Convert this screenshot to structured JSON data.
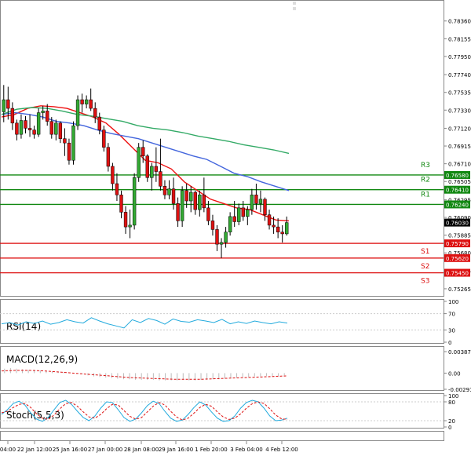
{
  "chart_data": [
    {
      "type": "candlestick",
      "panel": "price",
      "y_ticks": [
        "0.78360",
        "0.78155",
        "0.77950",
        "0.77740",
        "0.77535",
        "0.77330",
        "0.77120",
        "0.76915",
        "0.76710",
        "0.76505",
        "0.76295",
        "0.76090",
        "0.75885",
        "0.75680",
        "0.75475",
        "0.75265"
      ],
      "ylim": [
        0.7521,
        0.7853
      ],
      "x_labels": [
        "04:00",
        "22 Jan 12:00",
        "25 Jan 16:00",
        "27 Jan 00:00",
        "28 Jan 08:00",
        "29 Jan 16:00",
        "1 Feb 20:00",
        "3 Feb 04:00",
        "4 Feb 12:00"
      ],
      "candles": [
        {
          "o": 0.7731,
          "h": 0.7762,
          "l": 0.7719,
          "c": 0.7745
        },
        {
          "o": 0.7745,
          "h": 0.776,
          "l": 0.7722,
          "c": 0.7735
        },
        {
          "o": 0.7735,
          "h": 0.7742,
          "l": 0.771,
          "c": 0.7718
        },
        {
          "o": 0.7718,
          "h": 0.7722,
          "l": 0.7698,
          "c": 0.7705
        },
        {
          "o": 0.7705,
          "h": 0.7728,
          "l": 0.77,
          "c": 0.7721
        },
        {
          "o": 0.7721,
          "h": 0.7726,
          "l": 0.7706,
          "c": 0.7712
        },
        {
          "o": 0.7712,
          "h": 0.7728,
          "l": 0.7702,
          "c": 0.771
        },
        {
          "o": 0.771,
          "h": 0.7715,
          "l": 0.77,
          "c": 0.7705
        },
        {
          "o": 0.7705,
          "h": 0.7735,
          "l": 0.7702,
          "c": 0.773
        },
        {
          "o": 0.773,
          "h": 0.7738,
          "l": 0.7722,
          "c": 0.7732
        },
        {
          "o": 0.7732,
          "h": 0.774,
          "l": 0.7715,
          "c": 0.772
        },
        {
          "o": 0.772,
          "h": 0.7725,
          "l": 0.77,
          "c": 0.7705
        },
        {
          "o": 0.7705,
          "h": 0.7722,
          "l": 0.7698,
          "c": 0.7718
        },
        {
          "o": 0.7718,
          "h": 0.772,
          "l": 0.7695,
          "c": 0.77
        },
        {
          "o": 0.77,
          "h": 0.7712,
          "l": 0.768,
          "c": 0.7695
        },
        {
          "o": 0.7695,
          "h": 0.77,
          "l": 0.767,
          "c": 0.7675
        },
        {
          "o": 0.7675,
          "h": 0.772,
          "l": 0.767,
          "c": 0.7715
        },
        {
          "o": 0.7715,
          "h": 0.775,
          "l": 0.771,
          "c": 0.7745
        },
        {
          "o": 0.7745,
          "h": 0.7752,
          "l": 0.773,
          "c": 0.774
        },
        {
          "o": 0.774,
          "h": 0.775,
          "l": 0.7735,
          "c": 0.7745
        },
        {
          "o": 0.7745,
          "h": 0.7758,
          "l": 0.7732,
          "c": 0.7735
        },
        {
          "o": 0.7735,
          "h": 0.7742,
          "l": 0.7718,
          "c": 0.7725
        },
        {
          "o": 0.7725,
          "h": 0.773,
          "l": 0.7705,
          "c": 0.771
        },
        {
          "o": 0.771,
          "h": 0.7715,
          "l": 0.7685,
          "c": 0.769
        },
        {
          "o": 0.769,
          "h": 0.7695,
          "l": 0.7662,
          "c": 0.7668
        },
        {
          "o": 0.7668,
          "h": 0.7672,
          "l": 0.764,
          "c": 0.7648
        },
        {
          "o": 0.7648,
          "h": 0.766,
          "l": 0.7628,
          "c": 0.7635
        },
        {
          "o": 0.7635,
          "h": 0.764,
          "l": 0.7608,
          "c": 0.7615
        },
        {
          "o": 0.7615,
          "h": 0.7622,
          "l": 0.759,
          "c": 0.7598
        },
        {
          "o": 0.7598,
          "h": 0.7618,
          "l": 0.7585,
          "c": 0.76
        },
        {
          "o": 0.76,
          "h": 0.766,
          "l": 0.7595,
          "c": 0.7655
        },
        {
          "o": 0.7655,
          "h": 0.7695,
          "l": 0.765,
          "c": 0.769
        },
        {
          "o": 0.769,
          "h": 0.7698,
          "l": 0.7672,
          "c": 0.768
        },
        {
          "o": 0.768,
          "h": 0.7682,
          "l": 0.765,
          "c": 0.7655
        },
        {
          "o": 0.7655,
          "h": 0.7672,
          "l": 0.764,
          "c": 0.7668
        },
        {
          "o": 0.7668,
          "h": 0.769,
          "l": 0.765,
          "c": 0.7662
        },
        {
          "o": 0.7662,
          "h": 0.77,
          "l": 0.764,
          "c": 0.7645
        },
        {
          "o": 0.7645,
          "h": 0.7652,
          "l": 0.763,
          "c": 0.7635
        },
        {
          "o": 0.7635,
          "h": 0.7652,
          "l": 0.763,
          "c": 0.7642
        },
        {
          "o": 0.7642,
          "h": 0.7655,
          "l": 0.7618,
          "c": 0.7625
        },
        {
          "o": 0.7625,
          "h": 0.7632,
          "l": 0.7598,
          "c": 0.7605
        },
        {
          "o": 0.7605,
          "h": 0.7645,
          "l": 0.7598,
          "c": 0.764
        },
        {
          "o": 0.764,
          "h": 0.7648,
          "l": 0.762,
          "c": 0.7628
        },
        {
          "o": 0.7628,
          "h": 0.7645,
          "l": 0.7615,
          "c": 0.7638
        },
        {
          "o": 0.7638,
          "h": 0.764,
          "l": 0.7612,
          "c": 0.7618
        },
        {
          "o": 0.7618,
          "h": 0.764,
          "l": 0.761,
          "c": 0.7635
        },
        {
          "o": 0.7635,
          "h": 0.7655,
          "l": 0.7615,
          "c": 0.762
        },
        {
          "o": 0.762,
          "h": 0.7628,
          "l": 0.76,
          "c": 0.7605
        },
        {
          "o": 0.7605,
          "h": 0.7612,
          "l": 0.7588,
          "c": 0.7595
        },
        {
          "o": 0.7595,
          "h": 0.76,
          "l": 0.757,
          "c": 0.7578
        },
        {
          "o": 0.7578,
          "h": 0.7585,
          "l": 0.7562,
          "c": 0.758
        },
        {
          "o": 0.758,
          "h": 0.7598,
          "l": 0.7574,
          "c": 0.7592
        },
        {
          "o": 0.7592,
          "h": 0.7615,
          "l": 0.7588,
          "c": 0.761
        },
        {
          "o": 0.761,
          "h": 0.7628,
          "l": 0.7598,
          "c": 0.7604
        },
        {
          "o": 0.7604,
          "h": 0.7625,
          "l": 0.76,
          "c": 0.762
        },
        {
          "o": 0.762,
          "h": 0.7628,
          "l": 0.7605,
          "c": 0.761
        },
        {
          "o": 0.761,
          "h": 0.7622,
          "l": 0.76,
          "c": 0.7618
        },
        {
          "o": 0.7618,
          "h": 0.7642,
          "l": 0.7612,
          "c": 0.7635
        },
        {
          "o": 0.7635,
          "h": 0.7648,
          "l": 0.7618,
          "c": 0.7625
        },
        {
          "o": 0.7625,
          "h": 0.764,
          "l": 0.7615,
          "c": 0.763
        },
        {
          "o": 0.763,
          "h": 0.7632,
          "l": 0.7605,
          "c": 0.7612
        },
        {
          "o": 0.7612,
          "h": 0.7618,
          "l": 0.7595,
          "c": 0.76
        },
        {
          "o": 0.76,
          "h": 0.761,
          "l": 0.759,
          "c": 0.7598
        },
        {
          "o": 0.7598,
          "h": 0.7608,
          "l": 0.7585,
          "c": 0.7592
        },
        {
          "o": 0.7592,
          "h": 0.76,
          "l": 0.758,
          "c": 0.759
        },
        {
          "o": 0.759,
          "h": 0.761,
          "l": 0.7588,
          "c": 0.7603
        }
      ],
      "ma_lines": [
        {
          "name": "fast",
          "color": "#ee1111",
          "points": [
            0.7725,
            0.7728,
            0.7735,
            0.7738,
            0.7737,
            0.7735,
            0.773,
            0.7725,
            0.7718,
            0.7705,
            0.769,
            0.7675,
            0.7672,
            0.7665,
            0.765,
            0.764,
            0.763,
            0.7625,
            0.762,
            0.7618,
            0.7612,
            0.7606,
            0.7605
          ]
        },
        {
          "name": "medium",
          "color": "#4466dd",
          "points": [
            0.7728,
            0.773,
            0.7728,
            0.7725,
            0.772,
            0.7718,
            0.7715,
            0.771,
            0.7706,
            0.7703,
            0.77,
            0.7695,
            0.769,
            0.7685,
            0.768,
            0.7676,
            0.7668,
            0.766,
            0.7656,
            0.765,
            0.7645,
            0.764
          ]
        },
        {
          "name": "slow",
          "color": "#33aa66",
          "points": [
            0.7728,
            0.7734,
            0.7736,
            0.7735,
            0.7732,
            0.7728,
            0.7726,
            0.7723,
            0.772,
            0.7715,
            0.7712,
            0.771,
            0.7707,
            0.7703,
            0.77,
            0.7697,
            0.7693,
            0.769,
            0.7687,
            0.7683
          ]
        }
      ],
      "resistance": [
        {
          "label": "R3",
          "value": "0.76580",
          "y": 0.7658
        },
        {
          "label": "R2",
          "value": "0.76410",
          "y": 0.7641
        },
        {
          "label": "R1",
          "value": "0.76240",
          "y": 0.7624
        }
      ],
      "support": [
        {
          "label": "S1",
          "value": "0.75790",
          "y": 0.7579
        },
        {
          "label": "S2",
          "value": "0.75620",
          "y": 0.7562
        },
        {
          "label": "S3",
          "value": "0.75450",
          "y": 0.7545
        }
      ],
      "current": {
        "value": "0.76030",
        "y": 0.7603
      },
      "colors": {
        "resistance": "#118811",
        "support": "#dd1111",
        "bull": "#33aa33",
        "bear": "#dd1111"
      }
    },
    {
      "type": "line",
      "panel": "rsi",
      "title": "RSI(14)",
      "y_ticks": [
        "100",
        "70",
        "30",
        "0"
      ],
      "ylim": [
        0,
        100
      ],
      "values": [
        45,
        48,
        42,
        50,
        46,
        52,
        44,
        48,
        55,
        50,
        47,
        60,
        52,
        45,
        40,
        35,
        55,
        48,
        58,
        53,
        44,
        57,
        51,
        49,
        55,
        52,
        48,
        56,
        45,
        50,
        46,
        52,
        48,
        45,
        50,
        47
      ],
      "color": "#22aadd"
    },
    {
      "type": "bar",
      "panel": "macd",
      "title": "MACD(12,26,9)",
      "y_ticks": [
        "0.003875",
        "0.00",
        "-0.002911"
      ],
      "ylim": [
        -0.002911,
        0.003875
      ],
      "histogram": [
        0.0008,
        0.0009,
        0.0008,
        0.0007,
        0.0006,
        0.0006,
        0.0005,
        0.0004,
        0.0003,
        0.0003,
        0.0002,
        0.0001,
        0.0,
        -0.0002,
        -0.0004,
        -0.0006,
        -0.0007,
        -0.0008,
        -0.0009,
        -0.001,
        -0.0011,
        -0.0011,
        -0.0012,
        -0.0012,
        -0.0012,
        -0.0012,
        -0.0013,
        -0.0013,
        -0.0013,
        -0.0013,
        -0.0012,
        -0.0013,
        -0.0013,
        -0.0012,
        -0.0012,
        -0.0011,
        -0.0011,
        -0.001,
        -0.0009,
        -0.0008,
        -0.0007,
        -0.0007,
        -0.0006,
        -0.0006,
        -0.0005,
        -0.0005,
        -0.0005,
        -0.0004
      ],
      "signal": [
        0.0004,
        0.0005,
        0.0005,
        0.0004,
        0.0002,
        0.0,
        -0.0002,
        -0.0004,
        -0.0006,
        -0.0008,
        -0.0009,
        -0.001,
        -0.0011,
        -0.0011,
        -0.0011,
        -0.001,
        -0.0009,
        -0.0008,
        -0.0007,
        -0.0006,
        -0.0005
      ],
      "colors": {
        "histogram": "#bbbbbb",
        "signal": "#dd1111"
      }
    },
    {
      "type": "line",
      "panel": "stoch",
      "title": "Stoch(5,5,3)",
      "y_ticks": [
        "100",
        "80",
        "20",
        "0"
      ],
      "ylim": [
        0,
        100
      ],
      "k": [
        40,
        55,
        75,
        82,
        70,
        45,
        25,
        18,
        30,
        55,
        78,
        85,
        72,
        50,
        30,
        20,
        35,
        60,
        80,
        78,
        55,
        30,
        18,
        25,
        45,
        68,
        82,
        75,
        50,
        28,
        18,
        22,
        40,
        62,
        80,
        70,
        48,
        28,
        18,
        20,
        35,
        60,
        78,
        85,
        80,
        60,
        35,
        20,
        22,
        28
      ],
      "d": [
        45,
        50,
        62,
        72,
        75,
        62,
        42,
        28,
        24,
        38,
        58,
        74,
        78,
        66,
        48,
        32,
        28,
        40,
        58,
        72,
        70,
        52,
        34,
        25,
        30,
        48,
        66,
        78,
        70,
        50,
        32,
        22,
        28,
        44,
        62,
        72,
        66,
        48,
        32,
        24,
        28,
        42,
        60,
        74,
        80,
        75,
        58,
        38,
        26,
        24
      ],
      "colors": {
        "k": "#22aadd",
        "d": "#dd1111"
      }
    }
  ]
}
